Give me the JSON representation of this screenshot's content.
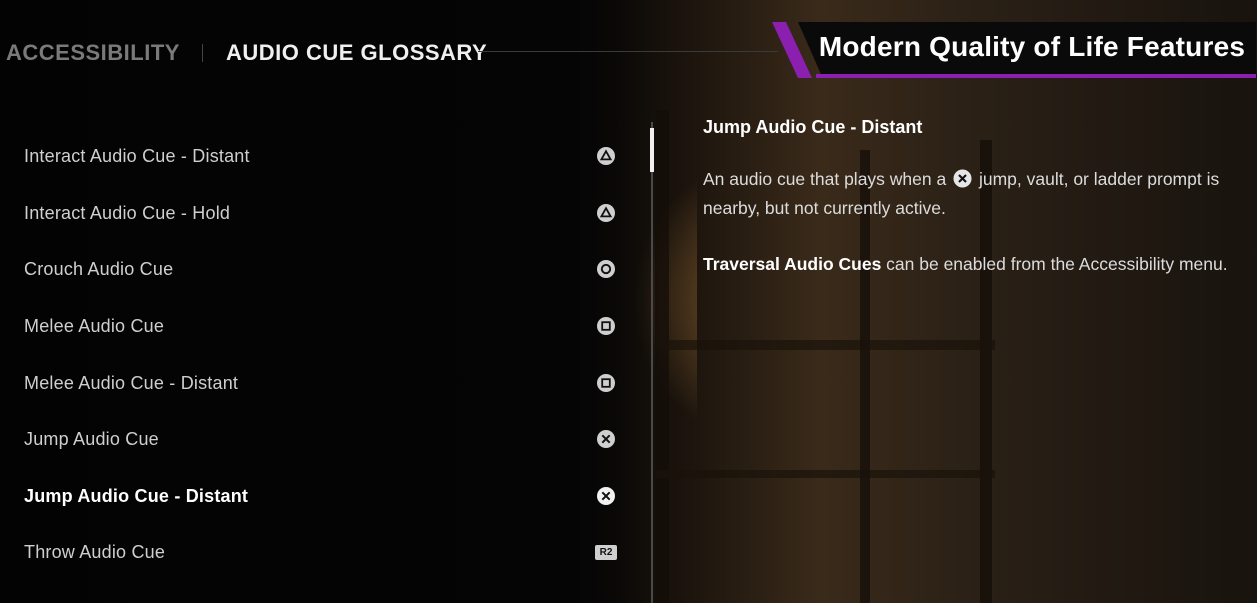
{
  "header": {
    "tabs": [
      {
        "label": "ACCESSIBILITY",
        "active": false
      },
      {
        "label": "AUDIO CUE GLOSSARY",
        "active": true
      }
    ]
  },
  "banner": {
    "title": "Modern Quality of Life Features",
    "accent_color": "#8a1fb0"
  },
  "list": {
    "items": [
      {
        "label": "Interact Audio Cue - Distant",
        "button": "triangle-icon"
      },
      {
        "label": "Interact Audio Cue - Hold",
        "button": "triangle-icon"
      },
      {
        "label": "Crouch Audio Cue",
        "button": "circle-icon"
      },
      {
        "label": "Melee Audio Cue",
        "button": "square-icon"
      },
      {
        "label": "Melee Audio Cue - Distant",
        "button": "square-icon"
      },
      {
        "label": "Jump Audio Cue",
        "button": "cross-icon"
      },
      {
        "label": "Jump Audio Cue - Distant",
        "button": "cross-icon",
        "selected": true
      },
      {
        "label": "Throw Audio Cue",
        "button": "r2-icon",
        "button_text": "R2"
      }
    ]
  },
  "detail": {
    "title": "Jump Audio Cue - Distant",
    "p1_before": "An audio cue that plays when a",
    "p1_after": "jump, vault, or ladder prompt is nearby, but not currently active.",
    "p2_bold": "Traversal Audio Cues",
    "p2_rest": " can be enabled from the Accessibility menu."
  }
}
